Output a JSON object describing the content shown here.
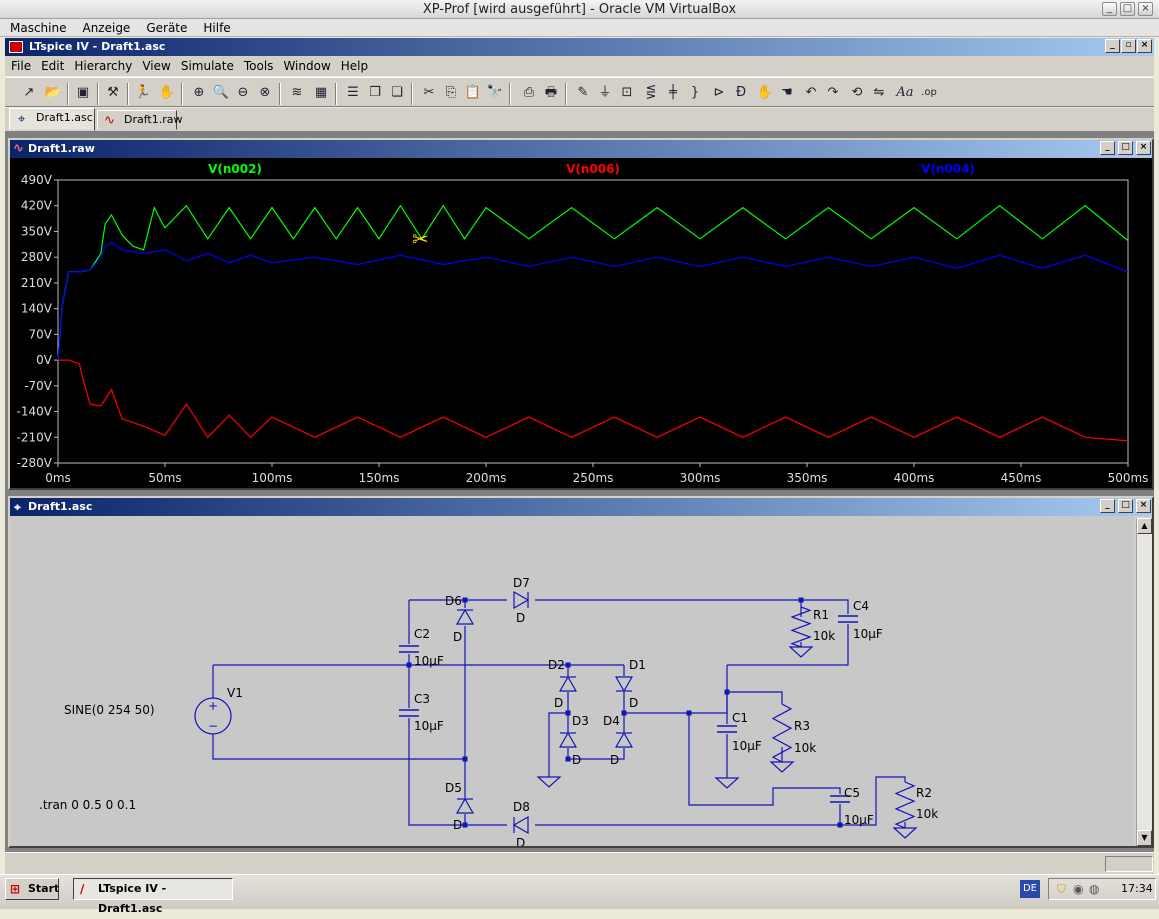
{
  "vm": {
    "title": "XP-Prof [wird ausgeführt] - Oracle VM VirtualBox",
    "menu": [
      "Maschine",
      "Anzeige",
      "Geräte",
      "Hilfe"
    ]
  },
  "app": {
    "title": "LTspice IV - Draft1.asc",
    "menu": [
      "File",
      "Edit",
      "Hierarchy",
      "View",
      "Simulate",
      "Tools",
      "Window",
      "Help"
    ]
  },
  "tabs": [
    {
      "label": "Draft1.asc",
      "active": true
    },
    {
      "label": "Draft1.raw",
      "active": false
    }
  ],
  "plot_window": {
    "title": "Draft1.raw"
  },
  "schematic_window": {
    "title": "Draft1.asc"
  },
  "chart_data": {
    "type": "line",
    "xlim": [
      0,
      500
    ],
    "ylim": [
      -280,
      490
    ],
    "x_tick_labels": [
      "0ms",
      "50ms",
      "100ms",
      "150ms",
      "200ms",
      "250ms",
      "300ms",
      "350ms",
      "400ms",
      "450ms",
      "500ms"
    ],
    "y_tick_labels": [
      "490V",
      "420V",
      "350V",
      "280V",
      "210V",
      "140V",
      "70V",
      "0V",
      "-70V",
      "-140V",
      "-210V",
      "-280V"
    ],
    "grid": false,
    "series": [
      {
        "name": "V(n002)",
        "color": "#00ff00",
        "x": [
          0,
          2,
          5,
          10,
          15,
          20,
          22,
          25,
          30,
          35,
          40,
          45,
          48,
          50,
          60,
          70,
          80,
          90,
          100,
          110,
          120,
          130,
          140,
          150,
          160,
          170,
          180,
          190,
          200,
          220,
          240,
          260,
          280,
          300,
          320,
          340,
          360,
          380,
          400,
          420,
          440,
          460,
          480,
          500
        ],
        "y": [
          0,
          150,
          240,
          240,
          245,
          290,
          370,
          395,
          340,
          310,
          300,
          415,
          380,
          360,
          420,
          330,
          415,
          330,
          415,
          330,
          415,
          330,
          415,
          330,
          420,
          330,
          420,
          330,
          415,
          330,
          415,
          330,
          415,
          330,
          415,
          330,
          415,
          330,
          415,
          330,
          420,
          330,
          420,
          325
        ]
      },
      {
        "name": "V(n006)",
        "color": "#ff0000",
        "x": [
          0,
          5,
          10,
          12,
          15,
          20,
          25,
          30,
          40,
          50,
          60,
          70,
          80,
          90,
          100,
          120,
          140,
          160,
          180,
          200,
          220,
          240,
          260,
          280,
          300,
          320,
          340,
          360,
          380,
          400,
          420,
          440,
          460,
          480,
          500
        ],
        "y": [
          0,
          0,
          -10,
          -60,
          -120,
          -125,
          -80,
          -160,
          -180,
          -205,
          -120,
          -210,
          -150,
          -210,
          -155,
          -210,
          -155,
          -210,
          -155,
          -210,
          -155,
          -210,
          -155,
          -210,
          -155,
          -210,
          -155,
          -210,
          -155,
          -210,
          -155,
          -210,
          -155,
          -210,
          -220
        ]
      },
      {
        "name": "V(n004)",
        "color": "#0000ff",
        "x": [
          0,
          2,
          5,
          10,
          15,
          20,
          22,
          25,
          30,
          40,
          50,
          60,
          70,
          80,
          90,
          100,
          120,
          140,
          160,
          180,
          200,
          220,
          240,
          260,
          280,
          300,
          320,
          340,
          360,
          380,
          400,
          420,
          440,
          460,
          480,
          500
        ],
        "y": [
          0,
          150,
          240,
          240,
          245,
          280,
          310,
          320,
          300,
          290,
          300,
          270,
          290,
          265,
          285,
          265,
          280,
          260,
          285,
          260,
          280,
          255,
          280,
          255,
          280,
          255,
          280,
          255,
          280,
          255,
          280,
          250,
          285,
          250,
          285,
          240
        ]
      }
    ]
  },
  "schematic": {
    "labels": [
      "D7",
      "D",
      "D6",
      "D",
      "C2",
      "10µF",
      "C3",
      "10µF",
      "V1",
      "SINE(0 254 50)",
      "D2",
      "D",
      "D1",
      "D",
      "D3",
      "D4",
      "D",
      "D",
      "D5",
      "D",
      "D8",
      "D",
      "R1",
      "10k",
      "C4",
      "10µF",
      "C1",
      "10µF",
      "R3",
      "10k",
      "C5",
      "10µF",
      "R2",
      "10k",
      ".tran 0 0.5 0 0.1"
    ]
  },
  "taskbar": {
    "start": "Start",
    "task": "LTspice IV - Draft1.asc",
    "lang": "DE",
    "clock": "17:34"
  }
}
